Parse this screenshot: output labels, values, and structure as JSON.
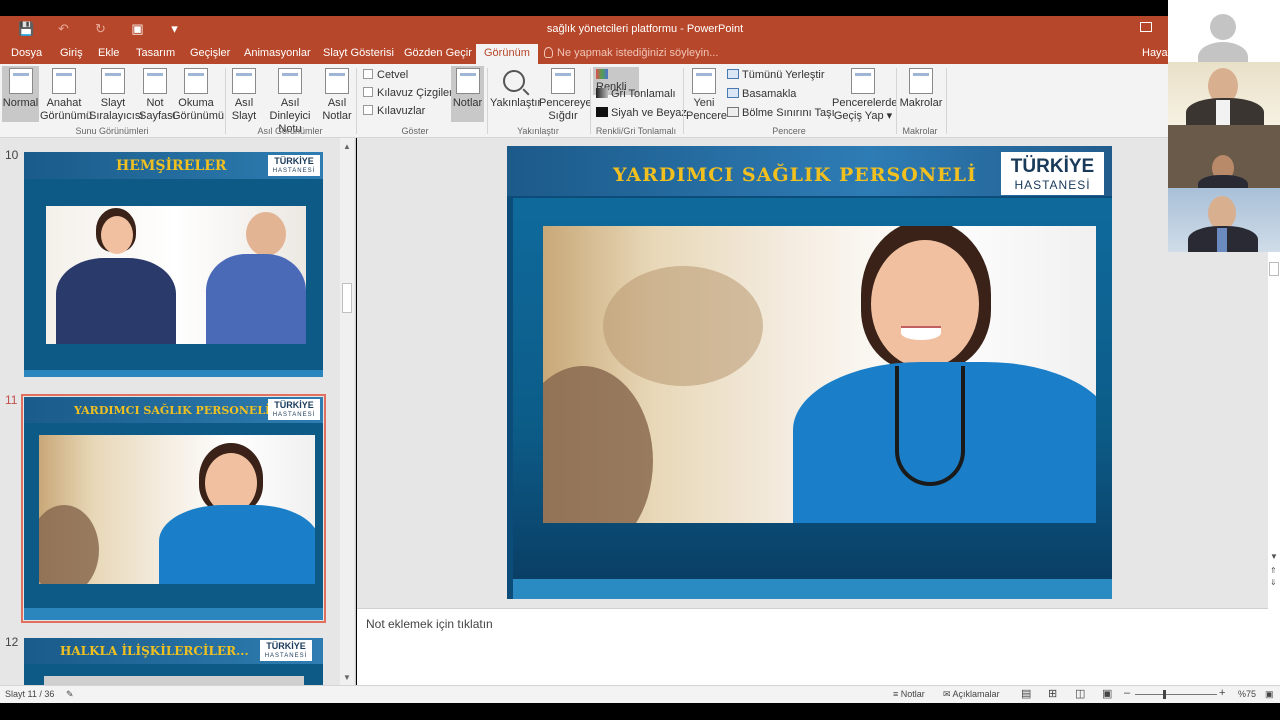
{
  "window": {
    "title": "sağlık yönetcileri platformu - PowerPoint",
    "qat_icons": [
      "save-icon",
      "undo-icon",
      "redo-icon",
      "present-icon",
      "customize-icon"
    ]
  },
  "menu": {
    "tabs": [
      "Dosya",
      "Giriş",
      "Ekle",
      "Tasarım",
      "Geçişler",
      "Animasyonlar",
      "Slayt Gösterisi",
      "Gözden Geçir",
      "Görünüm"
    ],
    "active_tab": "Görünüm",
    "tell_me": "Ne yapmak istediğinizi söyleyin...",
    "user": "Hayat"
  },
  "ribbon": {
    "groups": {
      "presentation_views": "Sunu Görünümleri",
      "master_views": "Asıl Görünümler",
      "show": "Göster",
      "zoom": "Yakınlaştır",
      "color": "Renkli/Gri Tonlamalı",
      "window": "Pencere",
      "macros": "Makrolar"
    },
    "buttons": {
      "normal": "Normal",
      "outline_1": "Anahat",
      "outline_2": "Görünümü",
      "sorter_1": "Slayt",
      "sorter_2": "Sıralayıcısı",
      "notes_page_1": "Not",
      "notes_page_2": "Sayfası",
      "reading_1": "Okuma",
      "reading_2": "Görünümü",
      "slide_master_1": "Asıl",
      "slide_master_2": "Slayt",
      "handout_master_1": "Asıl Dinleyici",
      "handout_master_2": "Notu",
      "notes_master_1": "Asıl",
      "notes_master_2": "Notlar",
      "ruler": "Cetvel",
      "gridlines": "Kılavuz Çizgileri",
      "guides": "Kılavuzlar",
      "notes": "Notlar",
      "zoom": "Yakınlaştır",
      "fit_1": "Pencereye",
      "fit_2": "Sığdır",
      "color": "Renkli",
      "grayscale": "Gri Tonlamalı",
      "bw": "Siyah ve Beyaz",
      "new_window_1": "Yeni",
      "new_window_2": "Pencere",
      "arrange_all": "Tümünü Yerleştir",
      "cascade": "Basamakla",
      "move_split": "Bölme Sınırını Taşı",
      "switch_1": "Pencerelerde",
      "switch_2": "Geçiş Yap",
      "macros": "Makrolar"
    },
    "checks": {
      "ruler": false,
      "gridlines": false,
      "guides": false
    },
    "colors": {
      "color": "#e07050",
      "grayscale": "#555555",
      "bw": "#111111"
    }
  },
  "thumbnails": [
    {
      "number": "10",
      "title": "HEMŞİRELER",
      "logo1": "TÜRKİYE",
      "logo2": "HASTANESİ",
      "selected": false
    },
    {
      "number": "11",
      "title": "YARDIMCI SAĞLIK PERSONELİ",
      "logo1": "TÜRKİYE",
      "logo2": "HASTANESİ",
      "selected": true
    },
    {
      "number": "12",
      "title": "HALKLA İLİŞKİLERCİLER...",
      "logo1": "TÜRKİYE",
      "logo2": "HASTANESİ",
      "selected": false
    }
  ],
  "slide": {
    "title": "YARDIMCI SAĞLIK PERSONELİ",
    "logo1": "TÜRKİYE",
    "logo2": "HASTANESİ"
  },
  "notes_placeholder": "Not eklemek için tıklatın",
  "status": {
    "slide_info": "Slayt 11 / 36",
    "notes": "Notlar",
    "comments": "Açıklamalar",
    "zoom": "%75"
  },
  "theme": {
    "accent": "#b7472a",
    "slide_title": "#f2c01e",
    "slide_bg": "#0b4d78"
  }
}
